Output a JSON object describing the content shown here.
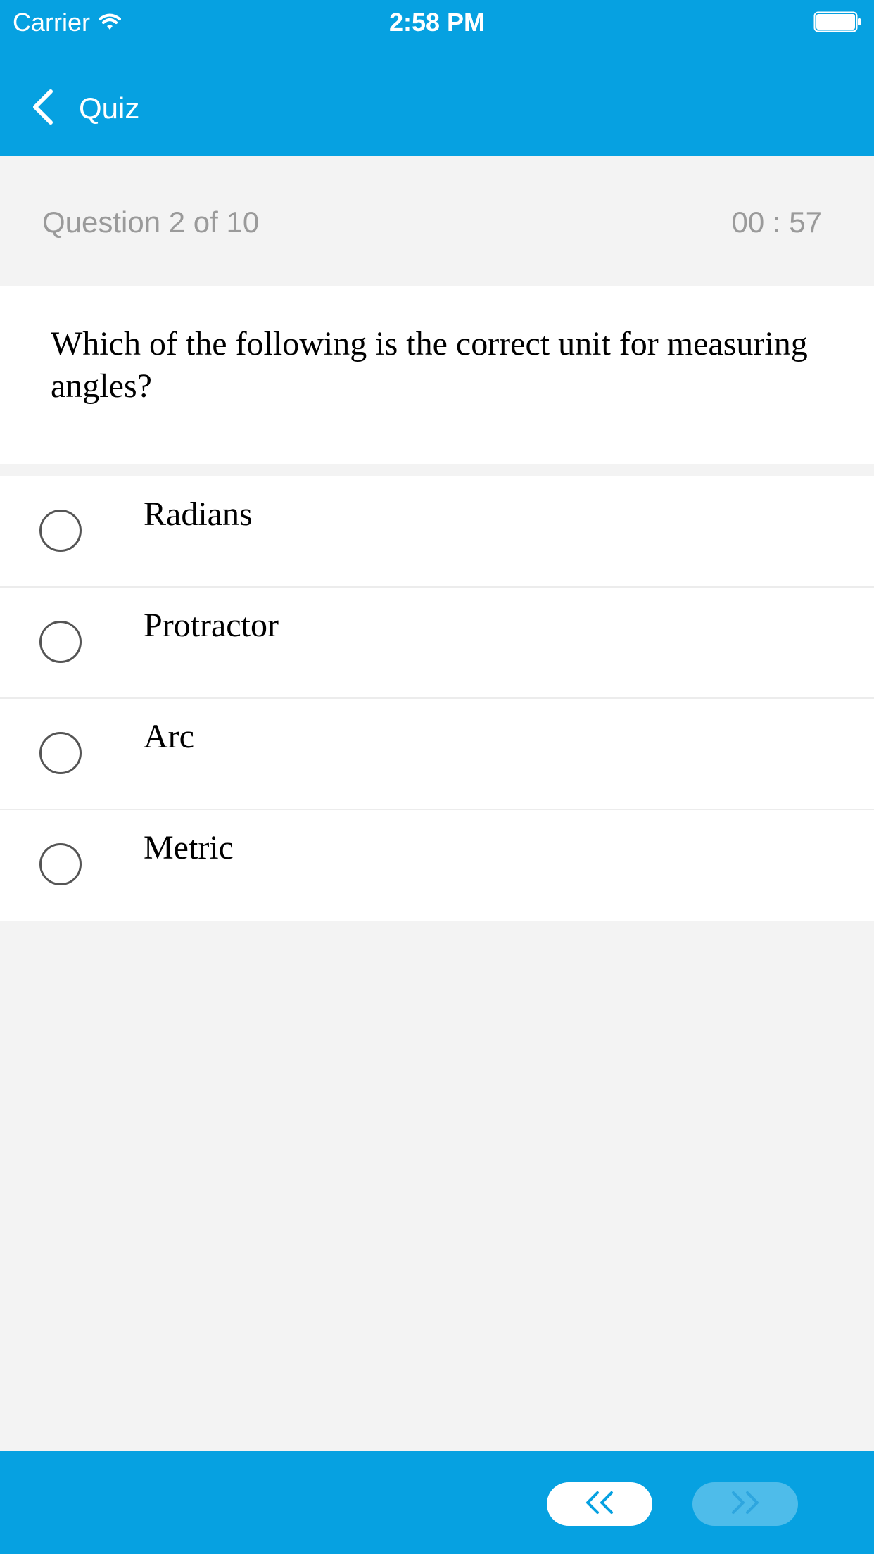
{
  "status_bar": {
    "carrier": "Carrier",
    "time": "2:58 PM",
    "wifi_icon": "wifi-icon",
    "battery_icon": "battery-icon"
  },
  "nav": {
    "back_icon": "chevron-left-icon",
    "title": "Quiz"
  },
  "quiz": {
    "progress": "Question 2 of 10",
    "timer": "00 : 57",
    "question": "Which of the following is the correct unit for measuring angles?",
    "answers": [
      {
        "label": "Radians",
        "selected": false
      },
      {
        "label": "Protractor",
        "selected": false
      },
      {
        "label": "Arc",
        "selected": false
      },
      {
        "label": "Metric",
        "selected": false
      }
    ]
  },
  "footer": {
    "prev_icon": "double-chevron-left-icon",
    "next_icon": "double-chevron-right-icon",
    "next_enabled": false
  },
  "colors": {
    "primary": "#06a1e1",
    "background": "#f3f3f3",
    "muted_text": "#9a9a9a",
    "disabled_button": "#4ebcea",
    "disabled_chevron": "#2ea6df"
  }
}
